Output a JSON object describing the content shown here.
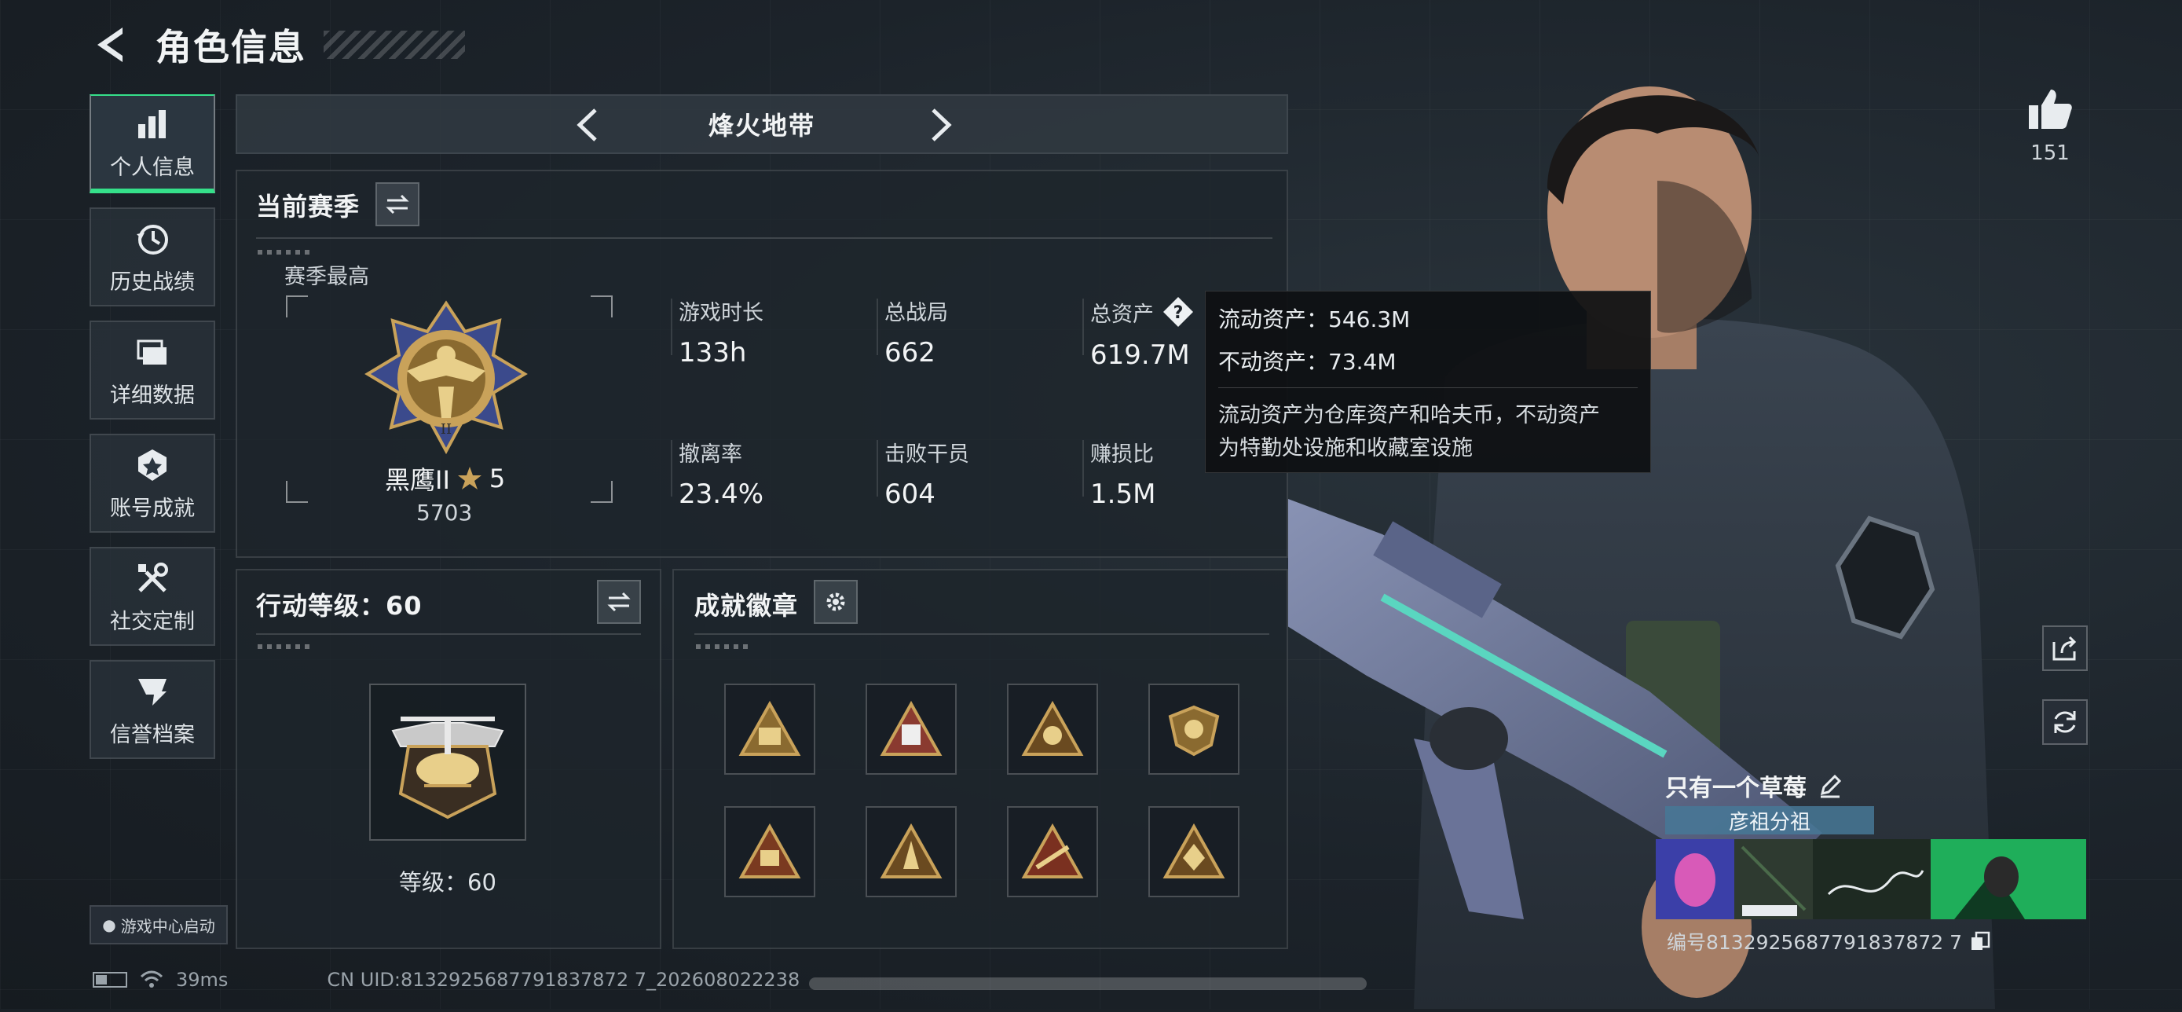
{
  "header": {
    "title": "角色信息"
  },
  "sidebar": {
    "items": [
      {
        "label": "个人信息",
        "icon": "bar-chart-icon",
        "active": true
      },
      {
        "label": "历史战绩",
        "icon": "history-clock-icon"
      },
      {
        "label": "详细数据",
        "icon": "folder-icon"
      },
      {
        "label": "账号成就",
        "icon": "achievement-icon"
      },
      {
        "label": "社交定制",
        "icon": "tools-icon"
      },
      {
        "label": "信誉档案",
        "icon": "reputation-icon"
      }
    ],
    "game_center_label": "游戏中心启动"
  },
  "mode": {
    "title": "烽火地带"
  },
  "season": {
    "title": "当前赛季",
    "best_label": "赛季最高",
    "rank_name": "黑鹰II",
    "rank_stars": "5",
    "rank_score": "5703",
    "stats": [
      {
        "label": "游戏时长",
        "value": "133h"
      },
      {
        "label": "总战局",
        "value": "662"
      },
      {
        "label": "总资产",
        "value": "619.7M"
      },
      {
        "label": "撤离率",
        "value": "23.4%"
      },
      {
        "label": "击败干员",
        "value": "604"
      },
      {
        "label": "赚损比",
        "value": "1.5M"
      }
    ]
  },
  "tooltip": {
    "liquid": "流动资产：546.3M",
    "fixed": "不动资产：73.4M",
    "desc_line1": "流动资产为仓库资产和哈夫币，不动资产",
    "desc_line2": "为特勤处设施和收藏室设施"
  },
  "action_level": {
    "title": "行动等级：60",
    "level_text": "等级：60"
  },
  "badges": {
    "title": "成就徽章"
  },
  "profile": {
    "likes": "151",
    "player_name": "只有一个草莓",
    "team": "彦祖分祖",
    "uid_short": "编号8132925687791837872 7"
  },
  "footer": {
    "ping": "39ms",
    "uid": "CN UID:8132925687791837872 7_202608022238"
  },
  "colors": {
    "accent_green": "#35e08a",
    "gold": "#c9a25a"
  }
}
